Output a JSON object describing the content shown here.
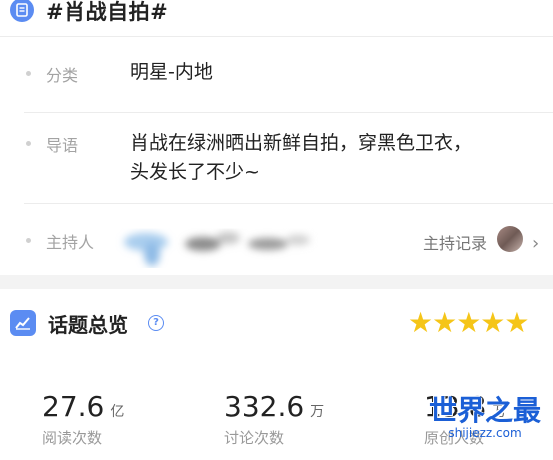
{
  "header": {
    "title": "#肖战自拍#"
  },
  "info": {
    "category": {
      "label": "分类",
      "value": "明星-内地"
    },
    "guide": {
      "label": "导语",
      "value_line1": "肖战在绿洲晒出新鲜自拍，穿黑色卫衣，",
      "value_line2": "头发长了不少~"
    },
    "host": {
      "label": "主持人",
      "record_label": "主持记录",
      "chevron": "›"
    }
  },
  "overview": {
    "title": "话题总览",
    "help": "?",
    "stars": "★★★★★",
    "rating_stars": 5
  },
  "stats": [
    {
      "num": "27.6",
      "unit": "亿",
      "caption": "阅读次数"
    },
    {
      "num": "332.6",
      "unit": "万",
      "caption": "讨论次数"
    },
    {
      "num": "13.8",
      "unit": "万",
      "caption": "原创人数"
    }
  ],
  "watermark": {
    "title": "世界之最",
    "url": "shijiezz.com"
  },
  "colors": {
    "accent": "#5b8cf2",
    "star": "#f5c518",
    "watermark": "#1b5fd6"
  }
}
